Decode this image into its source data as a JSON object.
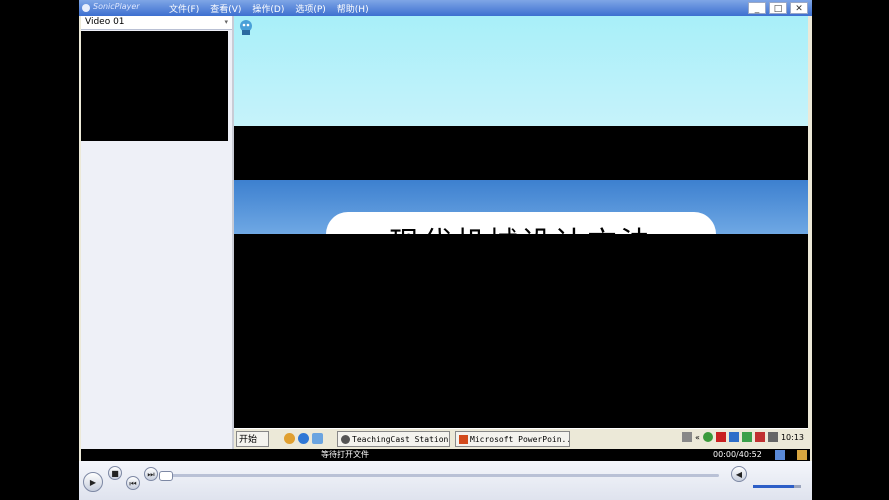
{
  "app": {
    "title": "SonicPlayer"
  },
  "menu": [
    "文件(F)",
    "查看(V)",
    "操作(D)",
    "选项(P)",
    "帮助(H)"
  ],
  "window_buttons": {
    "minimize": "_",
    "maximize": "□",
    "close": "✕"
  },
  "panel": {
    "selected_video": "Video 01",
    "dropdown_glyph": "▾"
  },
  "slide": {
    "title": "现代机械设计方法"
  },
  "taskbar": {
    "start_label": "开始",
    "tasks": [
      "TeachingCast Station",
      "Microsoft PowerPoin..."
    ],
    "chevron": "«",
    "clock": "10:13"
  },
  "status": {
    "message": "等待打开文件",
    "time": "00:00/40:52"
  },
  "playback": {
    "progress": 0.0,
    "volume": 0.85
  },
  "colors": {
    "title_bar": "#3d6fd0",
    "accent": "#2d5ec7",
    "slide_blue": "#3d80cf",
    "sky": "#a8eff9"
  },
  "icons": [
    "app-icon",
    "play-icon",
    "stop-icon",
    "previous-icon",
    "next-icon",
    "volume-icon",
    "mascot-icon",
    "folder-icon",
    "equalizer-icon"
  ]
}
